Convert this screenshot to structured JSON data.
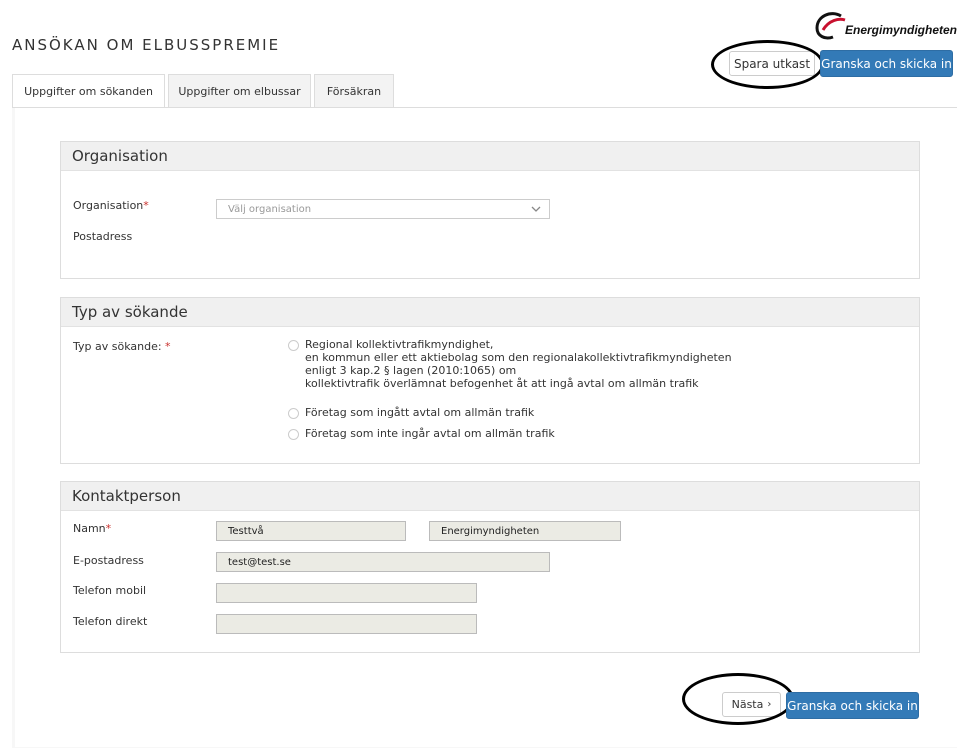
{
  "header": {
    "title": "ANSÖKAN OM ELBUSSPREMIE",
    "logo_text": "Energimyndigheten",
    "save_draft_label": "Spara utkast",
    "review_submit_label": "Granska och skicka in"
  },
  "tabs": [
    {
      "label": "Uppgifter om sökanden",
      "active": true
    },
    {
      "label": "Uppgifter om elbussar",
      "active": false
    },
    {
      "label": "Försäkran",
      "active": false
    }
  ],
  "organisation": {
    "heading": "Organisation",
    "org_label": "Organisation",
    "required_mark": "*",
    "org_placeholder": "Välj organisation",
    "postal_label": "Postadress"
  },
  "applicant_type": {
    "heading": "Typ av sökande",
    "label": "Typ av sökande: ",
    "required_mark": "*",
    "options": [
      {
        "lines": [
          "Regional kollektivtrafikmyndighet,",
          "en kommun eller ett aktiebolag som den regionalakollektivtrafikmyndigheten",
          "enligt 3 kap.2 § lagen (2010:1065) om",
          "kollektivtrafik överlämnat befogenhet åt att ingå avtal om allmän trafik"
        ]
      },
      {
        "lines": [
          "Företag som ingått avtal om allmän trafik"
        ]
      },
      {
        "lines": [
          "Företag som inte ingår avtal om allmän trafik"
        ]
      }
    ]
  },
  "contact": {
    "heading": "Kontaktperson",
    "name_label": "Namn",
    "required_mark": "*",
    "first_name": "Testtvå",
    "last_name": "Energimyndigheten",
    "email_label": "E-postadress",
    "email": "test@test.se",
    "mobile_label": "Telefon mobil",
    "mobile": "",
    "direct_label": "Telefon direkt",
    "direct": ""
  },
  "footer": {
    "next_label": "Nästa",
    "next_icon": "chevron-right-icon",
    "review_submit_label": "Granska och skicka in"
  },
  "colors": {
    "primary": "#337ab7",
    "required": "#c9302c",
    "logo_red": "#c8102e"
  }
}
